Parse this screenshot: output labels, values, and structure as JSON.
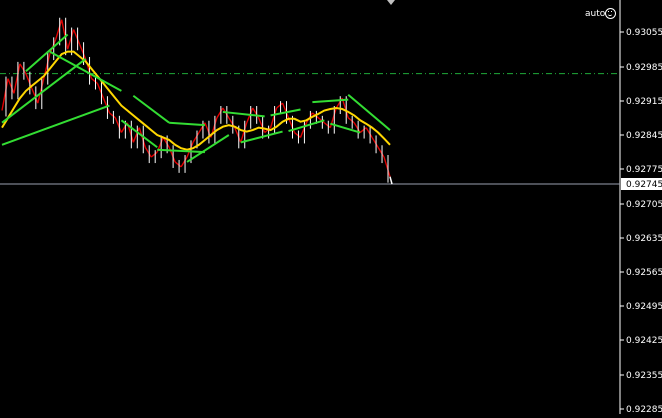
{
  "window": {
    "auto_label": "auto"
  },
  "colors": {
    "background": "#000000",
    "axis": "#ffffff",
    "price_line": "#9aa0b0",
    "level_line": "#1faa3a",
    "bars": "#e00000",
    "candles_white": "#ffffff",
    "ma": "#ffd700",
    "bands": "#33dd33",
    "price_box_bg": "#ffffff",
    "price_box_fg": "#000000"
  },
  "chart_data": {
    "type": "line",
    "y_ticks": [
      "0.93055",
      "0.92985",
      "0.92915",
      "0.92845",
      "0.92775",
      "0.92745",
      "0.92705",
      "0.92635",
      "0.92565",
      "0.92495",
      "0.92425",
      "0.92355",
      "0.92285"
    ],
    "current_price": "0.92745",
    "level_line_price": 0.9297,
    "ylim": [
      0.92285,
      0.931
    ],
    "price_series": [
      0.92895,
      0.9296,
      0.9293,
      0.9299,
      0.9297,
      0.9294,
      0.9291,
      0.9296,
      0.9301,
      0.9304,
      0.9308,
      0.9302,
      0.9306,
      0.9303,
      0.93,
      0.9296,
      0.9295,
      0.9292,
      0.9289,
      0.9288,
      0.9285,
      0.9287,
      0.9283,
      0.9286,
      0.9282,
      0.928,
      0.9281,
      0.9284,
      0.9282,
      0.9279,
      0.9278,
      0.928,
      0.9283,
      0.9285,
      0.9287,
      0.9284,
      0.9288,
      0.929,
      0.9288,
      0.9286,
      0.9283,
      0.9287,
      0.929,
      0.9288,
      0.9285,
      0.9286,
      0.929,
      0.9291,
      0.9288,
      0.9285,
      0.9284,
      0.9287,
      0.9289,
      0.9288,
      0.9287,
      0.9286,
      0.929,
      0.9292,
      0.9288,
      0.9287,
      0.9285,
      0.9286,
      0.9284,
      0.9282,
      0.928,
      0.9276
    ],
    "ma_series": [
      0.9286,
      0.9288,
      0.929,
      0.9292,
      0.92935,
      0.92945,
      0.92955,
      0.92965,
      0.9298,
      0.92995,
      0.9301,
      0.93015,
      0.93015,
      0.93005,
      0.92995,
      0.9298,
      0.92965,
      0.9295,
      0.92935,
      0.9292,
      0.92905,
      0.92895,
      0.92885,
      0.92875,
      0.92865,
      0.92855,
      0.92845,
      0.9284,
      0.92835,
      0.92825,
      0.92818,
      0.92815,
      0.92818,
      0.92825,
      0.92835,
      0.92845,
      0.92855,
      0.92862,
      0.92865,
      0.92862,
      0.92855,
      0.92852,
      0.92855,
      0.9286,
      0.92858,
      0.92855,
      0.92862,
      0.92872,
      0.92878,
      0.92878,
      0.92872,
      0.92875,
      0.92882,
      0.92888,
      0.92895,
      0.92898,
      0.929,
      0.92898,
      0.92892,
      0.92885,
      0.92875,
      0.92868,
      0.9286,
      0.9285,
      0.92838,
      0.92825
    ]
  }
}
